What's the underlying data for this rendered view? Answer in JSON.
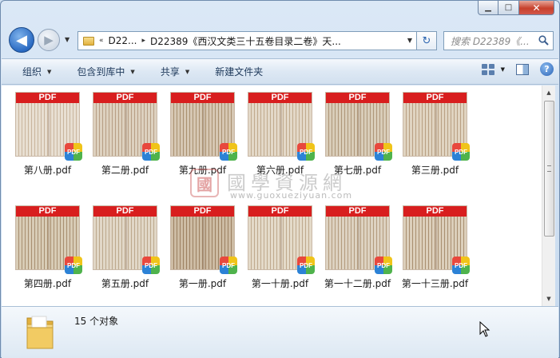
{
  "window": {
    "caption_buttons": {
      "minimize": "▁",
      "maximize": "□",
      "close": "✕"
    }
  },
  "nav": {
    "back_glyph": "◀",
    "forward_glyph": "▶",
    "address": {
      "prefix": "«",
      "crumb_1": "D22...",
      "separator": "▸",
      "crumb_2": "D22389《西汉文类三十五卷目录二卷》天..."
    },
    "refresh_glyph": "↻",
    "search_placeholder": "搜索 D22389《..."
  },
  "toolbar": {
    "organize": "组织",
    "include_in_library": "包含到库中",
    "share": "共享",
    "new_folder": "新建文件夹",
    "help": "?"
  },
  "badge_label": "PDF",
  "files": [
    {
      "name": "第八册.pdf"
    },
    {
      "name": "第二册.pdf"
    },
    {
      "name": "第九册.pdf"
    },
    {
      "name": "第六册.pdf"
    },
    {
      "name": "第七册.pdf"
    },
    {
      "name": "第三册.pdf"
    },
    {
      "name": "第四册.pdf"
    },
    {
      "name": "第五册.pdf"
    },
    {
      "name": "第一册.pdf"
    },
    {
      "name": "第一十册.pdf"
    },
    {
      "name": "第一十二册.pdf"
    },
    {
      "name": "第一十三册.pdf"
    }
  ],
  "watermark": {
    "seal": "國",
    "title": "國學資源網",
    "url": "www.guoxueziyuan.com"
  },
  "status": {
    "count_text": "15 个对象"
  },
  "colors": {
    "pdf_red": "#d81e1e",
    "accent_blue": "#2a6ac2"
  }
}
